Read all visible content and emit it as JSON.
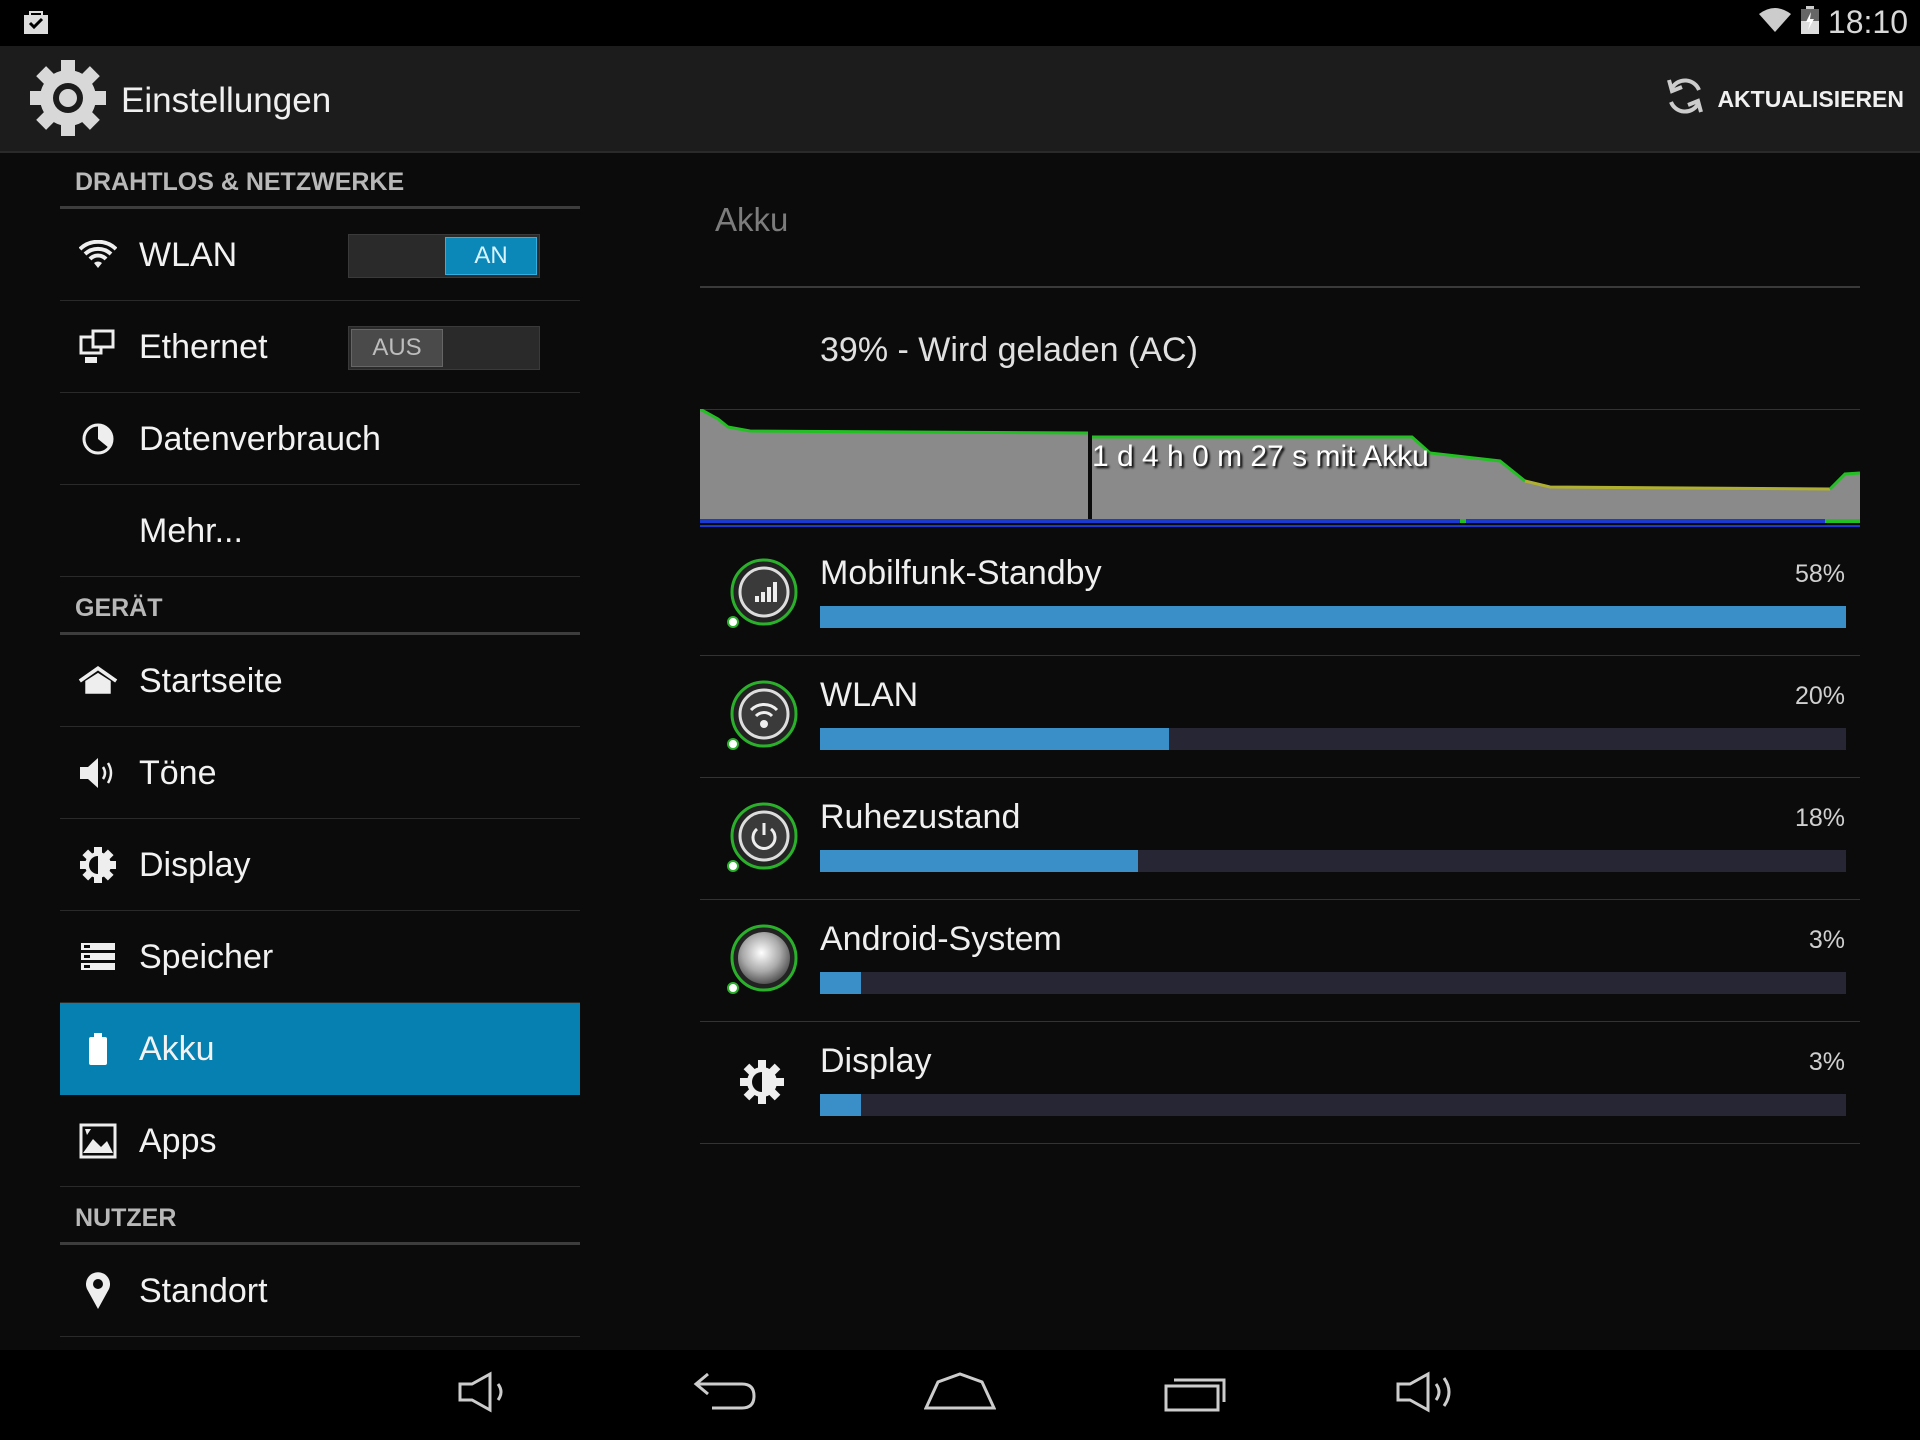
{
  "statusbar": {
    "time": "18:10",
    "icons": [
      "notification-bag-icon",
      "wifi-icon",
      "battery-charging-icon"
    ]
  },
  "actionbar": {
    "title": "Einstellungen",
    "app_icon": "settings-gear-icon",
    "refresh_label": "AKTUALISIEREN",
    "refresh_icon": "refresh-icon"
  },
  "sidebar": {
    "sections": [
      {
        "header": "DRAHTLOS & NETZWERKE",
        "items": [
          {
            "label": "WLAN",
            "icon": "wifi-icon",
            "toggle": "AN",
            "toggle_on": true
          },
          {
            "label": "Ethernet",
            "icon": "ethernet-icon",
            "toggle": "AUS",
            "toggle_on": false
          },
          {
            "label": "Datenverbrauch",
            "icon": "data-usage-icon"
          },
          {
            "label": "Mehr...",
            "icon": ""
          }
        ]
      },
      {
        "header": "GERÄT",
        "items": [
          {
            "label": "Startseite",
            "icon": "home-icon"
          },
          {
            "label": "Töne",
            "icon": "speaker-icon"
          },
          {
            "label": "Display",
            "icon": "brightness-icon"
          },
          {
            "label": "Speicher",
            "icon": "storage-icon"
          },
          {
            "label": "Akku",
            "icon": "battery-icon",
            "selected": true
          },
          {
            "label": "Apps",
            "icon": "apps-icon"
          }
        ]
      },
      {
        "header": "NUTZER",
        "items": [
          {
            "label": "Standort",
            "icon": "location-pin-icon"
          }
        ]
      }
    ]
  },
  "main": {
    "heading": "Akku",
    "status": "39% - Wird geladen (AC)",
    "graph_label": "1 d 4 h 0 m 27 s mit Akku",
    "usage": [
      {
        "name": "Mobilfunk-Standby",
        "percent_label": "58%",
        "fraction": 1.0,
        "icon": "cell-signal-icon"
      },
      {
        "name": "WLAN",
        "percent_label": "20%",
        "fraction": 0.34,
        "icon": "wifi-icon"
      },
      {
        "name": "Ruhezustand",
        "percent_label": "18%",
        "fraction": 0.31,
        "icon": "power-icon"
      },
      {
        "name": "Android-System",
        "percent_label": "3%",
        "fraction": 0.04,
        "icon": "android-system-icon"
      },
      {
        "name": "Display",
        "percent_label": "3%",
        "fraction": 0.04,
        "icon": "brightness-icon"
      }
    ]
  },
  "navbar": {
    "buttons": [
      "volume-down-icon",
      "back-icon",
      "home-icon",
      "recents-icon",
      "volume-up-icon"
    ]
  },
  "colors": {
    "accent": "#0580b0",
    "bar_fill": "#3a8fc8",
    "bar_track": "#262634",
    "graph_fill": "#8a8a8a",
    "graph_line": "#22c022"
  }
}
